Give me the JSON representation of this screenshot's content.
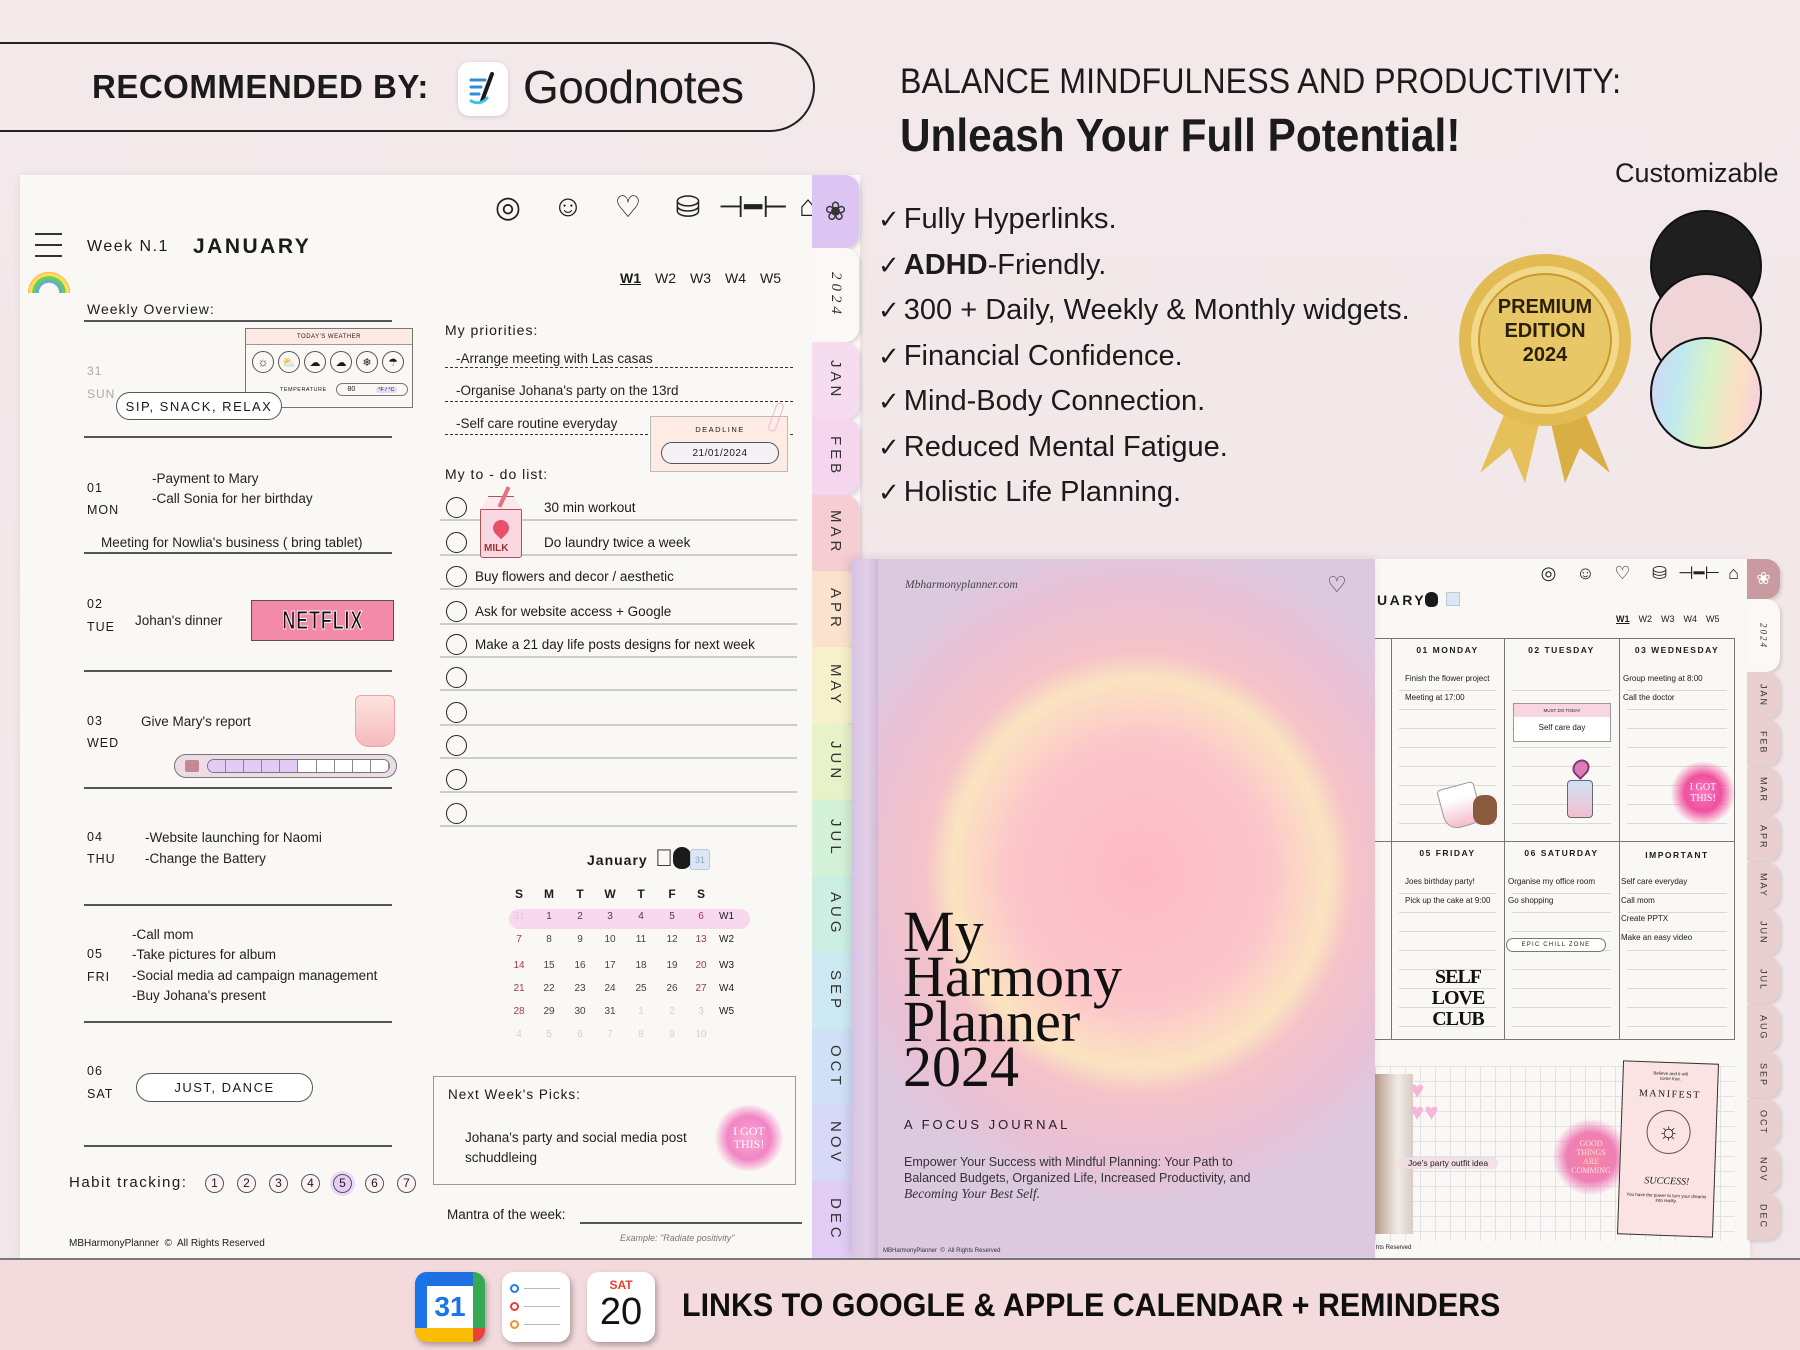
{
  "banner": {
    "recommended_label": "RECOMMENDED BY:",
    "brand": "Goodnotes"
  },
  "headline": {
    "line1": "BALANCE MINDFULNESS AND PRODUCTIVITY:",
    "line2": "Unleash Your Full Potential!"
  },
  "features": [
    {
      "bold": "",
      "text": "Fully Hyperlinks."
    },
    {
      "bold": "ADHD",
      "text": "-Friendly."
    },
    {
      "bold": "",
      "text": "300 + Daily, Weekly & Monthly widgets."
    },
    {
      "bold": "",
      "text": "Financial Confidence."
    },
    {
      "bold": "",
      "text": "Mind-Body Connection."
    },
    {
      "bold": "",
      "text": "Reduced Mental Fatigue."
    },
    {
      "bold": "",
      "text": "Holistic Life Planning."
    }
  ],
  "badge": {
    "line1": "PREMIUM",
    "line2": "EDITION",
    "line3": "2024"
  },
  "customizable": {
    "label": "Customizable",
    "swatches": [
      "#1f1f1f",
      "#f0d5d8",
      "holographic"
    ]
  },
  "weekly_planner": {
    "week_label": "Week N.1",
    "month": "JANUARY",
    "week_tabs": [
      "W1",
      "W2",
      "W3",
      "W4",
      "W5"
    ],
    "active_week": "W1",
    "icons": [
      "target-icon",
      "smile-icon",
      "heartbeat-icon",
      "coins-icon",
      "dumbbell-icon",
      "home-heart-icon"
    ],
    "overview_label": "Weekly Overview:",
    "weather": {
      "title": "TODAY'S WEATHER",
      "temp_label": "TEMPERATURE",
      "temp_value": "80",
      "unit": "°F / °C"
    },
    "days": {
      "sun": {
        "num": "31",
        "name": "SUN",
        "pill": "SIP, SNACK, RELAX"
      },
      "mon": {
        "num": "01",
        "name": "MON",
        "items": [
          "-Payment to Mary",
          "-Call Sonia for her birthday"
        ],
        "note": "Meeting for Nowlia's business ( bring tablet)"
      },
      "tue": {
        "num": "02",
        "name": "TUE",
        "items": [
          "Johan's dinner"
        ],
        "sticker": "NETFLIX"
      },
      "wed": {
        "num": "03",
        "name": "WED",
        "items": [
          "Give Mary's report"
        ],
        "progress": 0.5
      },
      "thu": {
        "num": "04",
        "name": "THU",
        "items": [
          "-Website launching for Naomi",
          "-Change the Battery"
        ]
      },
      "fri": {
        "num": "05",
        "name": "FRI",
        "items": [
          "-Call mom",
          "-Take pictures for album",
          "-Social media ad campaign management",
          "-Buy Johana's present"
        ]
      },
      "sat": {
        "num": "06",
        "name": "SAT",
        "pill": "JUST, DANCE"
      }
    },
    "priorities_label": "My priorities:",
    "priorities": [
      "-Arrange meeting with Las casas",
      "-Organise Johana's party on the 13rd",
      "-Self care routine everyday"
    ],
    "deadline": {
      "label": "DEADLINE",
      "date": "21/01/2024"
    },
    "todo_label": "My to - do list:",
    "todos": [
      "30 min workout",
      "Do laundry twice a week",
      "Buy flowers and decor / aesthetic",
      "Ask for website access + Google",
      "Make a 21 day life posts designs for next week",
      "",
      "",
      "",
      "",
      ""
    ],
    "milk_sticker": "MILK",
    "calendar": {
      "month": "January",
      "headers": [
        "S",
        "M",
        "T",
        "W",
        "T",
        "F",
        "S"
      ],
      "rows": [
        {
          "week": "W1",
          "days": [
            "31",
            "1",
            "2",
            "3",
            "4",
            "5",
            "6"
          ]
        },
        {
          "week": "W2",
          "days": [
            "7",
            "8",
            "9",
            "10",
            "11",
            "12",
            "13"
          ]
        },
        {
          "week": "W3",
          "days": [
            "14",
            "15",
            "16",
            "17",
            "18",
            "19",
            "20"
          ]
        },
        {
          "week": "W4",
          "days": [
            "21",
            "22",
            "23",
            "24",
            "25",
            "26",
            "27"
          ]
        },
        {
          "week": "W5",
          "days": [
            "28",
            "29",
            "30",
            "31",
            "1",
            "2",
            "3"
          ]
        },
        {
          "week": "",
          "days": [
            "4",
            "5",
            "6",
            "7",
            "8",
            "9",
            "10"
          ]
        }
      ],
      "gcal_day": "31"
    },
    "next_week": {
      "label": "Next Week's Picks:",
      "text": "Johana's party and social media post schuddleing",
      "sticker": "I GOT THIS!"
    },
    "habit": {
      "label": "Habit tracking:",
      "items": [
        "1",
        "2",
        "3",
        "4",
        "5",
        "6",
        "7"
      ],
      "selected": "5"
    },
    "mantra": {
      "label": "Mantra of the week:",
      "example": "Example: \"Radiate positivity\""
    },
    "footer": "MBHarmonyPlanner  ©  All Rights Reserved",
    "tabs": [
      {
        "label": "2024",
        "color": "#fbf8f6"
      },
      {
        "label": "JAN",
        "color": "#f6dcef"
      },
      {
        "label": "FEB",
        "color": "#f5d6ee"
      },
      {
        "label": "MAR",
        "color": "#f6cdd2"
      },
      {
        "label": "APR",
        "color": "#fbe2cf"
      },
      {
        "label": "MAY",
        "color": "#f7f1cb"
      },
      {
        "label": "JUN",
        "color": "#e7f2c9"
      },
      {
        "label": "JUL",
        "color": "#d3f2d7"
      },
      {
        "label": "AUG",
        "color": "#cbf0e3"
      },
      {
        "label": "SEP",
        "color": "#cdeaf3"
      },
      {
        "label": "OCT",
        "color": "#cfe0f7"
      },
      {
        "label": "NOV",
        "color": "#d8d8f8"
      },
      {
        "label": "DEC",
        "color": "#e2cef5"
      }
    ],
    "lotus_tab_color": "#dcc4f3"
  },
  "cover": {
    "website": "Mbharmonyplanner.com",
    "title_lines": [
      "My",
      "Harmony",
      "Planner",
      "2024"
    ],
    "subtitle": "A FOCUS JOURNAL",
    "description": "Empower Your Success with Mindful Planning: Your Path to Balanced Budgets, Organized Life, Increased Productivity, and",
    "description_italic": "Becoming Your Best Self.",
    "footer": "MBHarmonyPlanner  ©  All Rights Reserved"
  },
  "daily_planner": {
    "month_partial": "UARY",
    "week_tabs": [
      "W1",
      "W2",
      "W3",
      "W4",
      "W5"
    ],
    "cells": [
      {
        "title": "01 MONDAY",
        "items": [
          "Finish the flower project",
          "Meeting at 17:00"
        ]
      },
      {
        "title": "02 TUESDAY",
        "items": [],
        "box_label": "MUST DO TODAY",
        "box_text": "Self care day"
      },
      {
        "title": "03 WEDNESDAY",
        "items": [
          "Group meeting at 8:00",
          "Call the doctor"
        ],
        "sticker": "I GOT THIS!"
      },
      {
        "title": "05 FRIDAY",
        "items": [
          "Joes birthday party!",
          "Pick up the cake at 9:00"
        ],
        "sticker": "SELF LOVE CLUB"
      },
      {
        "title": "06 SATURDAY",
        "items": [
          "Organise my office room",
          "Go shopping"
        ],
        "pill": "EPIC CHILL ZONE"
      },
      {
        "title": "IMPORTANT",
        "items": [
          "Self care everyday",
          "Call mom",
          "Create PPTX",
          "Make an easy video"
        ]
      }
    ],
    "outfit_caption": "Joe's party outfit idea",
    "good_things": "GOOD THINGS ARE COMMING",
    "manifest": {
      "top": "Believe and it will come true.",
      "title": "MANIFEST",
      "bottom_title": "SUCCESS!",
      "bottom": "You have the power to turn your dreams into reality."
    },
    "footer_partial": "hts Reserved",
    "tabs": [
      "2024",
      "JAN",
      "FEB",
      "MAR",
      "APR",
      "MAY",
      "JUN",
      "JUL",
      "AUG",
      "SEP",
      "OCT",
      "NOV",
      "DEC"
    ],
    "tab_color": "#e9cfd0",
    "lotus_tab_color": "#c99a9f"
  },
  "footer_band": {
    "label": "LINKS TO GOOGLE & APPLE CALENDAR + REMINDERS",
    "gcal_day": "31",
    "apple_day_name": "SAT",
    "apple_day": "20",
    "background": "#f3dadd"
  }
}
